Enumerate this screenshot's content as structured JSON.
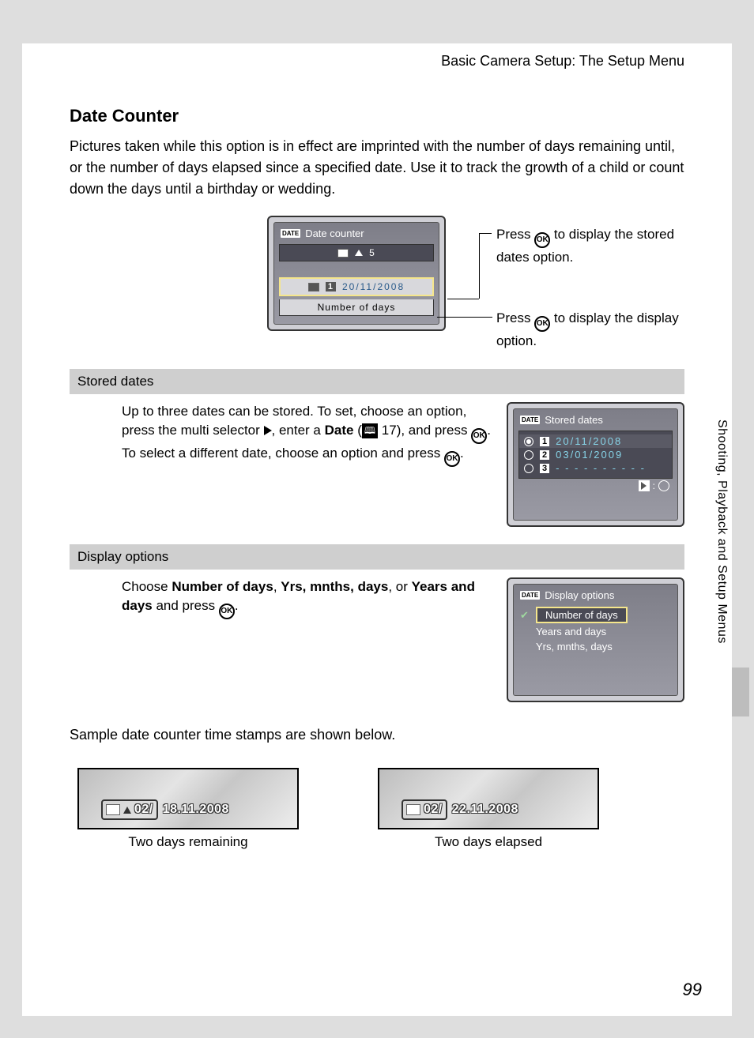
{
  "header": "Basic Camera Setup: The Setup Menu",
  "title": "Date Counter",
  "intro": "Pictures taken while this option is in effect are imprinted with the number of days remaining until, or the number of days elapsed since a specified date. Use it to track the growth of a child or count down the days until a birthday or wedding.",
  "main_lcd": {
    "title": "Date counter",
    "row1_value": "5",
    "row2_date": "20/11/2008",
    "row3_label": "Number of days"
  },
  "callout1": {
    "pre": "Press ",
    "post": " to display the stored dates option."
  },
  "callout2": {
    "pre": "Press ",
    "post": " to display the display option."
  },
  "ok_label": "OK",
  "stored": {
    "bar": "Stored dates",
    "text_a": "Up to three dates can be stored. To set, choose an option, press the multi selector ",
    "text_b": ", enter a ",
    "date_word": "Date",
    "text_c": " (",
    "ref": "17",
    "text_d": "), and press ",
    "text_e": ". To select a different date, choose an option and press ",
    "text_f": ".",
    "lcd_title": "Stored dates",
    "items": [
      {
        "num": "1",
        "date": "20/11/2008"
      },
      {
        "num": "2",
        "date": "03/01/2009"
      },
      {
        "num": "3",
        "date": "- - - - - - - - - -"
      }
    ]
  },
  "display": {
    "bar": "Display options",
    "text_a": "Choose ",
    "opt1": "Number of days",
    "comma": ", ",
    "opt2": "Yrs, mnths, days",
    "or": ", or ",
    "opt3": "Years and days",
    "text_b": " and press ",
    "text_c": ".",
    "lcd_title": "Display options",
    "items": [
      "Number of days",
      "Years and days",
      "Yrs, mnths, days"
    ]
  },
  "sample_intro": "Sample date counter time stamps are shown below.",
  "samples": [
    {
      "counter": "02/",
      "date": "18.11.2008",
      "caption": "Two days remaining",
      "triangle": true
    },
    {
      "counter": "02/",
      "date": "22.11.2008",
      "caption": "Two days elapsed",
      "triangle": false
    }
  ],
  "side_tab": "Shooting, Playback and Setup Menus",
  "page_number": "99",
  "date_badge": "DATE"
}
